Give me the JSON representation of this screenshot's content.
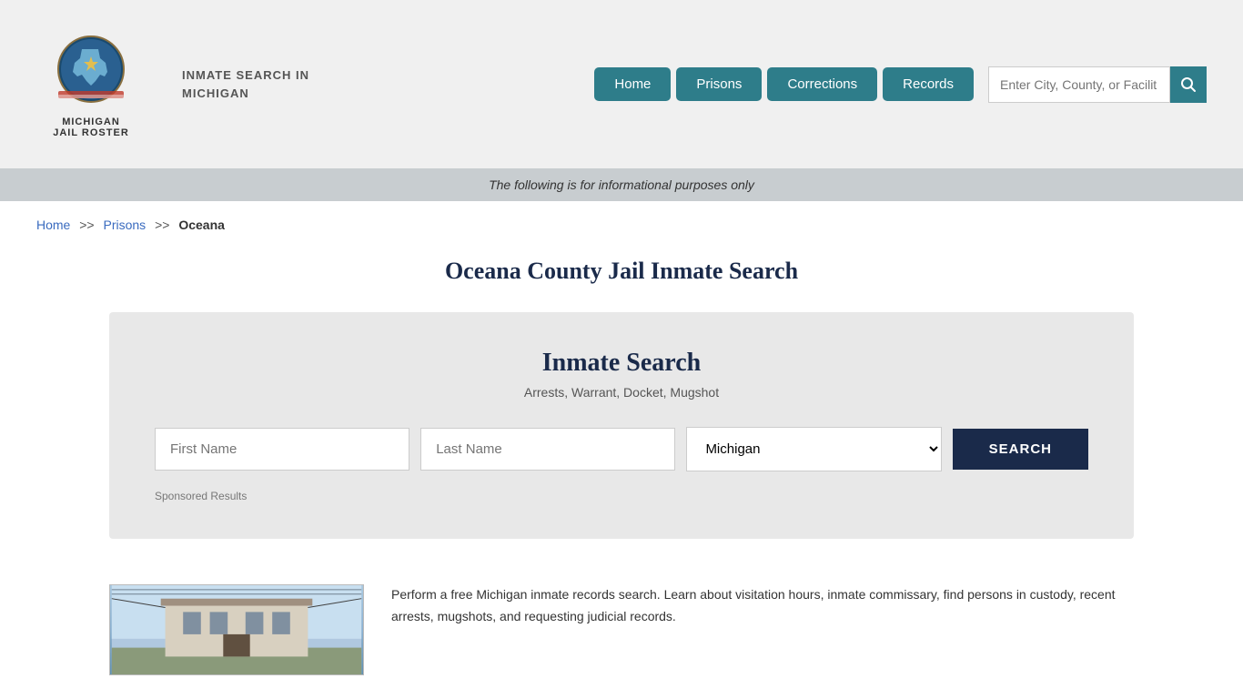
{
  "header": {
    "logo_title": "MICHIGAN\nJAIL ROSTER",
    "site_subtitle": "INMATE SEARCH IN\nMICHIGAN",
    "nav": {
      "home_label": "Home",
      "prisons_label": "Prisons",
      "corrections_label": "Corrections",
      "records_label": "Records"
    },
    "search_placeholder": "Enter City, County, or Facilit"
  },
  "info_bar": {
    "text": "The following is for informational purposes only"
  },
  "breadcrumb": {
    "home_label": "Home",
    "sep1": ">>",
    "prisons_label": "Prisons",
    "sep2": ">>",
    "current": "Oceana"
  },
  "page": {
    "title": "Oceana County Jail Inmate Search"
  },
  "search_card": {
    "title": "Inmate Search",
    "subtitle": "Arrests, Warrant, Docket, Mugshot",
    "first_name_placeholder": "First Name",
    "last_name_placeholder": "Last Name",
    "state_default": "Michigan",
    "search_button_label": "SEARCH",
    "sponsored_label": "Sponsored Results"
  },
  "bottom": {
    "description": "Perform a free Michigan inmate records search. Learn about visitation hours, inmate commissary, find persons in custody, recent arrests, mugshots, and requesting judicial records."
  }
}
